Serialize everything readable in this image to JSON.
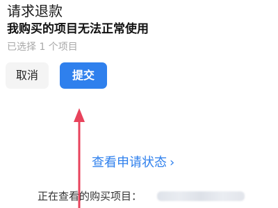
{
  "header": {
    "title": "请求退款",
    "reason": "我购买的项目无法正常使用",
    "selected_count": "已选择 1 个项目"
  },
  "actions": {
    "cancel_label": "取消",
    "submit_label": "提交"
  },
  "status_link": {
    "label": "查看申请状态",
    "chevron_icon": "chevron-right-icon"
  },
  "purchase": {
    "label": "正在查看的购买项目：",
    "id_redacted": true
  },
  "annotation": {
    "arrow_icon": "red-arrow-up-icon",
    "color": "#e8435c"
  },
  "colors": {
    "accent": "#2f80ed",
    "muted_text": "#a8a8a8",
    "cancel_bg": "#f4f4f4"
  }
}
